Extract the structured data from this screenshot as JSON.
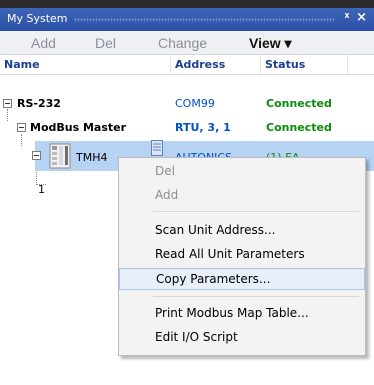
{
  "panel": {
    "title": "My System",
    "pin_icon": "pin-icon",
    "close_icon": "close-icon"
  },
  "toolbar": {
    "add_label": "Add",
    "del_label": "Del",
    "change_label": "Change",
    "view_label": "View ▾"
  },
  "columns": {
    "name": "Name",
    "address": "Address",
    "status": "Status"
  },
  "tree": {
    "rs232": {
      "name": "RS-232",
      "address": "COM99",
      "status": "Connected"
    },
    "modbus": {
      "name": "ModBus Master",
      "address": "RTU, 3, 1",
      "status": "Connected"
    },
    "device": {
      "name": "TMH4",
      "address": "AUTONICS",
      "status": "(1) EA"
    },
    "child": {
      "name": "1"
    }
  },
  "colors": {
    "header_text": "#1c3f8f",
    "address_text": "#0050c8",
    "status_text": "#0a8a0a",
    "selected_bg": "#b7d3f3",
    "titlebar": "#2b52a8"
  },
  "context_menu": {
    "del": "Del",
    "add": "Add",
    "scan": "Scan Unit Address...",
    "read": "Read All Unit Parameters",
    "copy": "Copy Parameters...",
    "print": "Print Modbus Map Table...",
    "edit": "Edit I/O Script"
  }
}
